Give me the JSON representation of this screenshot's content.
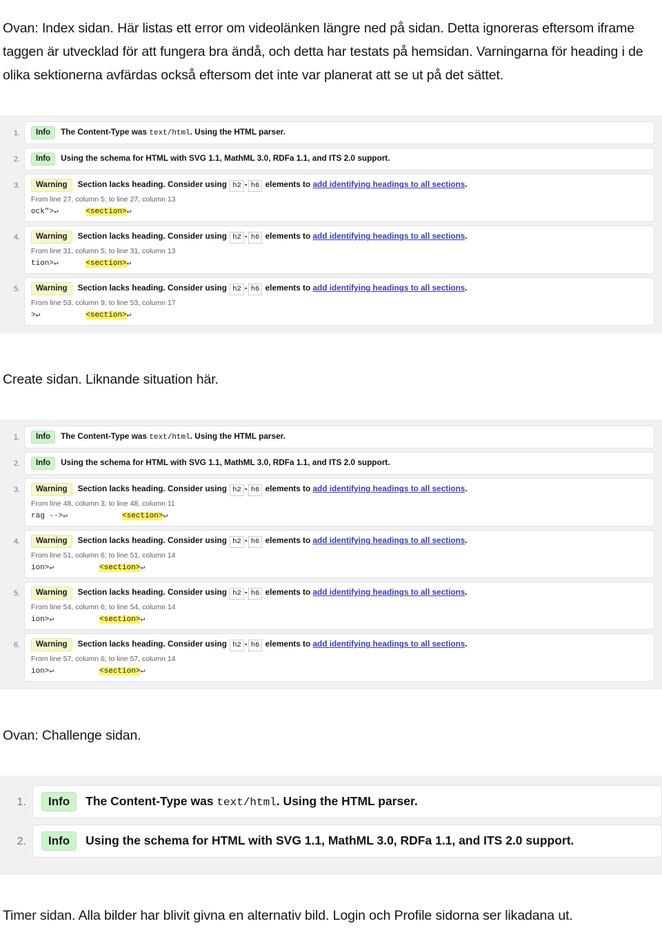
{
  "document": {
    "language": "sv",
    "intro_paragraph": "Ovan: Index sidan. Här listas ett error om videolänken längre ned på sidan. Detta ignoreras eftersom iframe taggen är utvecklad för att fungera bra ändå, och detta har testats på hemsidan. Varningarna för heading i de olika sektionerna avfärdas också eftersom det inte var planerat att se ut på det sättet.",
    "middle_paragraph": "Create sidan. Liknande situation här.",
    "third_caption": "Ovan: Challenge sidan.",
    "closing_paragraph": "Timer sidan. Alla bilder har blivit givna en alternativ bild. Login och Profile sidorna ser likadana ut."
  },
  "colors": {
    "panel_background": "#f1f1f1",
    "card_background": "#ffffff",
    "card_border": "#e2e2e2",
    "info_badge_bg": "#cdf3cd",
    "warning_badge_bg": "#f7f6cc",
    "link": "#3b3bb0",
    "highlight": "#fdf36a",
    "muted_text": "#5c5c5c"
  },
  "labels": {
    "info": "Info",
    "warning": "Warning",
    "link_text": "add identifying headings to all sections",
    "code_h2": "h2",
    "code_h6": "h6",
    "code_dash": "-",
    "content_type_prefix": "The Content-Type was ",
    "content_type_code": "text/html",
    "content_type_suffix": ". Using the HTML parser.",
    "schema_text": "Using the schema for HTML with SVG 1.1, MathML 3.0, RDFa 1.1, and ITS 2.0 support.",
    "section_lacks_prefix": "Section lacks heading. Consider using ",
    "section_lacks_mid": " elements to ",
    "section_lacks_suffix": ".",
    "section_tag": "<section>",
    "cr_symbol": "↵"
  },
  "validator_blocks": [
    {
      "id": "index-page-results",
      "scale": "small",
      "messages": [
        {
          "index": "1.",
          "type": "info",
          "kind": "content-type"
        },
        {
          "index": "2.",
          "type": "info",
          "kind": "schema"
        },
        {
          "index": "3.",
          "type": "warning",
          "kind": "section-lacks-heading",
          "location": "From line 27, column 5; to line 27, column 13",
          "extract_before": "ock\">↵",
          "extract_gap": "      ",
          "extract_highlight": "<section>",
          "extract_after": "↵"
        },
        {
          "index": "4.",
          "type": "warning",
          "kind": "section-lacks-heading",
          "location": "From line 31, column 5; to line 31, column 13",
          "extract_before": "tion>↵",
          "extract_gap": "      ",
          "extract_highlight": "<section>",
          "extract_after": "↵"
        },
        {
          "index": "5.",
          "type": "warning",
          "kind": "section-lacks-heading",
          "location": "From line 53, column 9; to line 53, column 17",
          "extract_before": ">↵",
          "extract_gap": "          ",
          "extract_highlight": "<section>",
          "extract_after": "↵"
        }
      ]
    },
    {
      "id": "create-page-results",
      "scale": "small",
      "messages": [
        {
          "index": "1.",
          "type": "info",
          "kind": "content-type"
        },
        {
          "index": "2.",
          "type": "info",
          "kind": "schema"
        },
        {
          "index": "3.",
          "type": "warning",
          "kind": "section-lacks-heading",
          "location": "From line 48, column 3; to line 48, column 11",
          "extract_before": "rag -->↵",
          "extract_gap": "            ",
          "extract_highlight": "<section>",
          "extract_after": "↵"
        },
        {
          "index": "4.",
          "type": "warning",
          "kind": "section-lacks-heading",
          "location": "From line 51, column 6; to line 51, column 14",
          "extract_before": "ion>↵",
          "extract_gap": "          ",
          "extract_highlight": "<section>",
          "extract_after": "↵"
        },
        {
          "index": "5.",
          "type": "warning",
          "kind": "section-lacks-heading",
          "location": "From line 54, column 6; to line 54, column 14",
          "extract_before": "ion>↵",
          "extract_gap": "          ",
          "extract_highlight": "<section>",
          "extract_after": "↵"
        },
        {
          "index": "6.",
          "type": "warning",
          "kind": "section-lacks-heading",
          "location": "From line 57, column 6; to line 57, column 14",
          "extract_before": "ion>↵",
          "extract_gap": "          ",
          "extract_highlight": "<section>",
          "extract_after": "↵"
        }
      ]
    },
    {
      "id": "challenge-page-results",
      "scale": "large",
      "messages": [
        {
          "index": "1.",
          "type": "info",
          "kind": "content-type"
        },
        {
          "index": "2.",
          "type": "info",
          "kind": "schema"
        }
      ]
    }
  ]
}
